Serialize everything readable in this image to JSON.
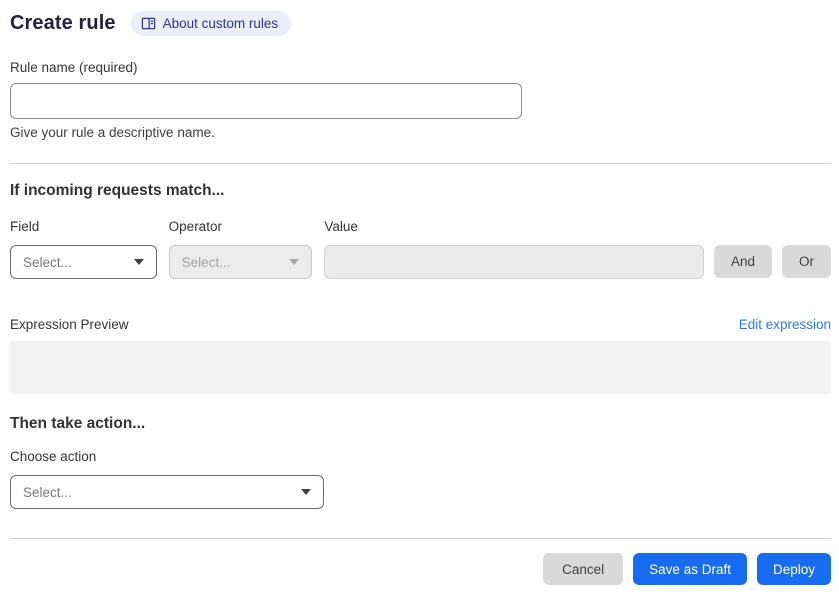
{
  "page": {
    "title": "Create rule",
    "about_badge_label": "About custom rules"
  },
  "rule_name": {
    "label": "Rule name (required)",
    "value": "",
    "helper": "Give your rule a descriptive name."
  },
  "match_section": {
    "heading": "If incoming requests match...",
    "field": {
      "label": "Field",
      "selected": "Select..."
    },
    "operator": {
      "label": "Operator",
      "selected": "Select..."
    },
    "value_input": {
      "label": "Value",
      "value": ""
    },
    "and_button": "And",
    "or_button": "Or"
  },
  "expression": {
    "preview_label": "Expression Preview",
    "edit_link": "Edit expression",
    "preview_content": ""
  },
  "action_section": {
    "heading": "Then take action...",
    "choose_label": "Choose action",
    "selected": "Select..."
  },
  "footer": {
    "cancel": "Cancel",
    "save_draft": "Save as Draft",
    "deploy": "Deploy"
  },
  "colors": {
    "primary_blue": "#176cf0",
    "link_blue": "#2c7be0",
    "badge_bg": "#edeefb",
    "badge_text": "#30309f"
  }
}
